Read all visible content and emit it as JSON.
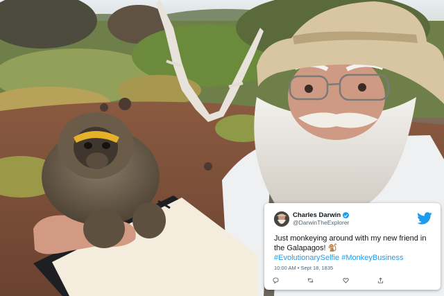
{
  "tweet": {
    "name": "Charles Darwin",
    "handle": "@DarwinTheExplorer",
    "text": "Just monkeying around with my new friend in the Galapagos! 🐒",
    "hashtags": "#EvolutionarySelfie #MonkeyBusiness",
    "timestamp": "10:00 AM • Sept 18, 1835",
    "brand_color": "#1d9bf0",
    "icons": [
      "reply-icon",
      "retweet-icon",
      "like-icon",
      "share-icon"
    ]
  }
}
